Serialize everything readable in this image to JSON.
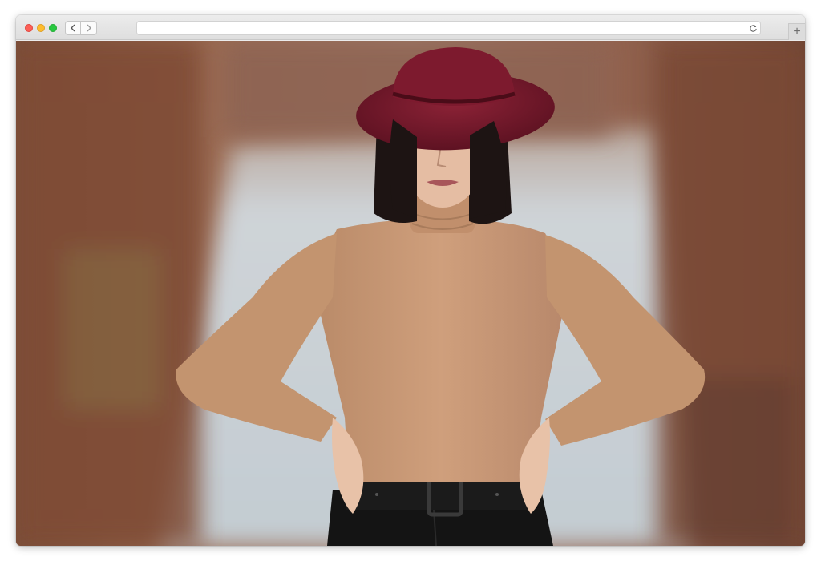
{
  "browser": {
    "url_value": "",
    "back_label": "Back",
    "forward_label": "Forward",
    "new_tab_glyph": "+"
  },
  "icons": {
    "back": "chevron-left-icon",
    "forward": "chevron-right-icon",
    "reload": "reload-icon",
    "new_tab": "plus-icon"
  },
  "colors": {
    "close": "#fd5f57",
    "minimize": "#febc2e",
    "maximize": "#28c840",
    "hat": "#7a1a2c",
    "sweater": "#c99a77",
    "background_reeds": "#8a5c44",
    "water": "#c7d0d6"
  }
}
